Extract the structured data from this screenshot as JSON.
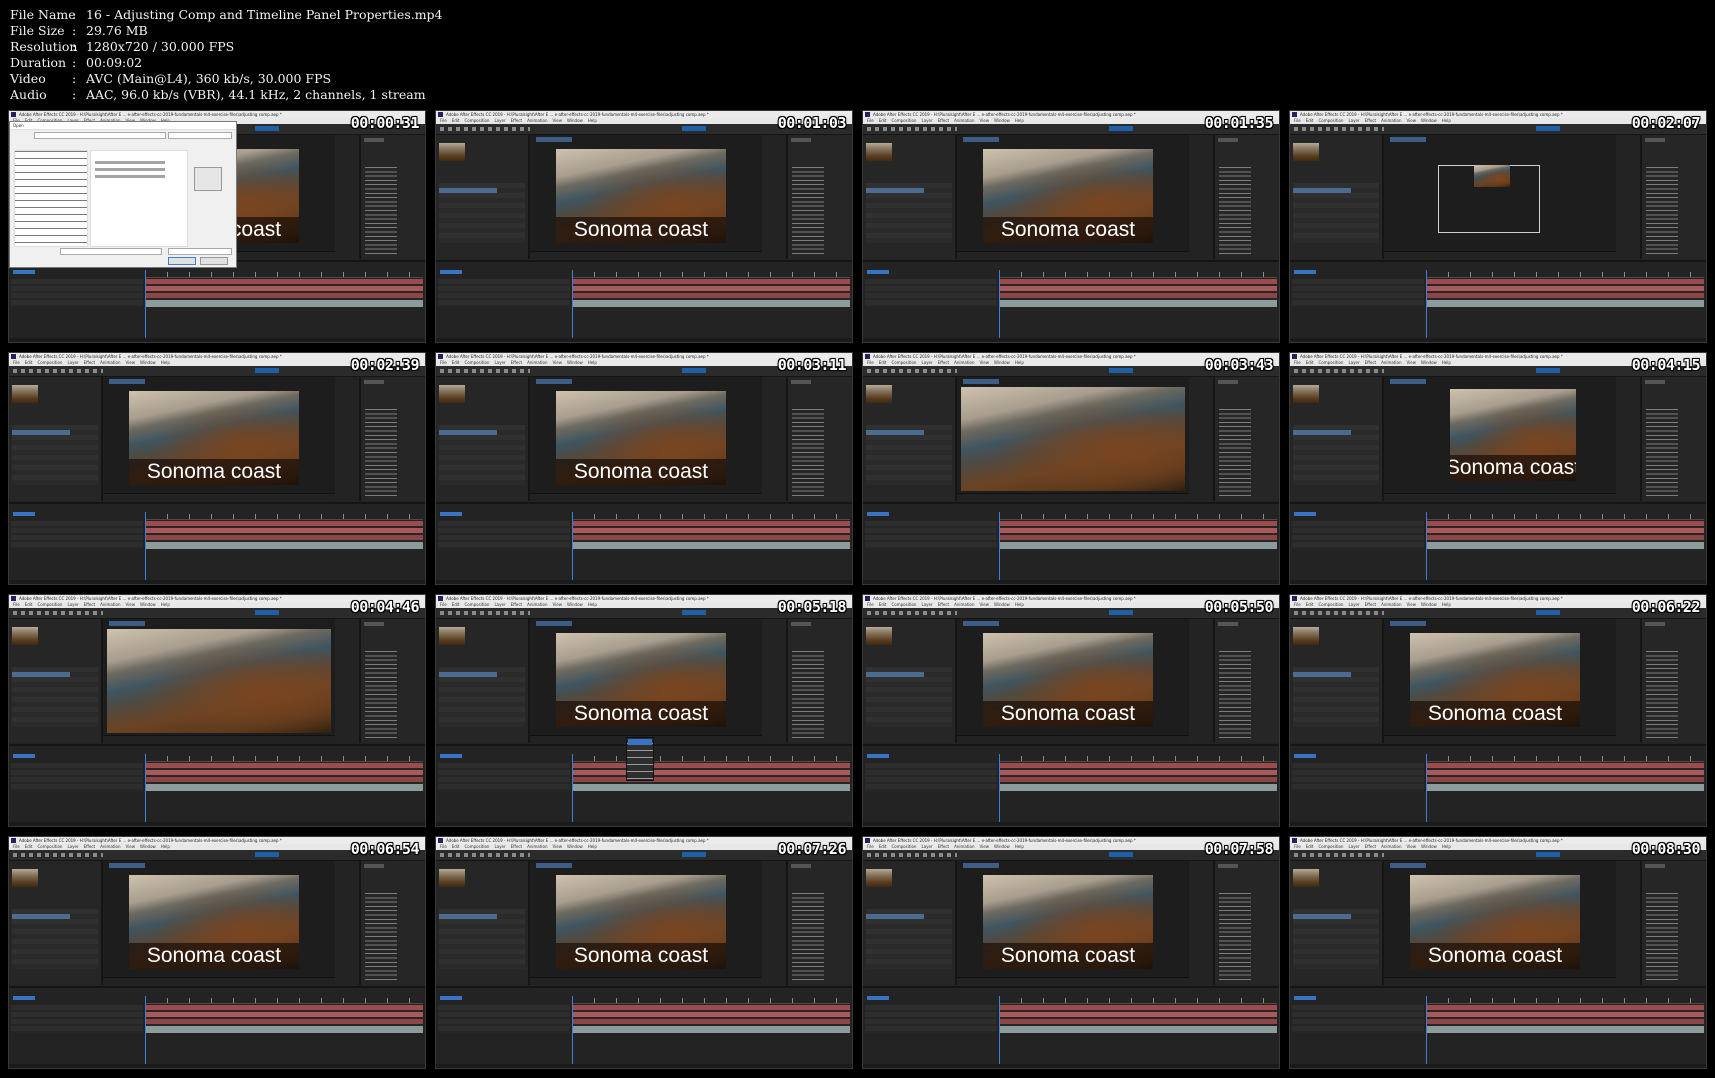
{
  "meta": {
    "rows": [
      {
        "key": "File Name",
        "value": "16 - Adjusting Comp and Timeline Panel Properties.mp4"
      },
      {
        "key": "File Size",
        "value": "29.76 MB"
      },
      {
        "key": "Resolution",
        "value": "1280x720 / 30.000 FPS"
      },
      {
        "key": "Duration",
        "value": "00:09:02"
      },
      {
        "key": "Video",
        "value": "AVC (Main@L4), 360 kb/s, 30.000 FPS"
      },
      {
        "key": "Audio",
        "value": "AAC, 96.0 kb/s (VBR), 44.1 kHz, 2 channels, 1 stream"
      }
    ],
    "separator": ":"
  },
  "app": {
    "window_title": "Adobe After Effects CC 2019 - H:\\Pluralsight\\After E ... e-after-effects-cc-2019-fundamentals-m4-exercise-files\\adjusting comp.aep *",
    "menu": [
      "File",
      "Edit",
      "Composition",
      "Layer",
      "Effect",
      "Animation",
      "View",
      "Window",
      "Help"
    ],
    "comp_title_text": "Sonoma coast"
  },
  "thumbnails": [
    {
      "timestamp": "00:00:31",
      "view": "open-dialog"
    },
    {
      "timestamp": "00:01:03",
      "view": "comp"
    },
    {
      "timestamp": "00:01:35",
      "view": "comp"
    },
    {
      "timestamp": "00:02:07",
      "view": "zoomed-out"
    },
    {
      "timestamp": "00:02:39",
      "view": "comp"
    },
    {
      "timestamp": "00:03:11",
      "view": "comp"
    },
    {
      "timestamp": "00:03:43",
      "view": "full-frame"
    },
    {
      "timestamp": "00:04:15",
      "view": "boxed"
    },
    {
      "timestamp": "00:04:46",
      "view": "full-frame"
    },
    {
      "timestamp": "00:05:18",
      "view": "dropdown"
    },
    {
      "timestamp": "00:05:50",
      "view": "comp"
    },
    {
      "timestamp": "00:06:22",
      "view": "comp"
    },
    {
      "timestamp": "00:06:54",
      "view": "comp"
    },
    {
      "timestamp": "00:07:26",
      "view": "comp"
    },
    {
      "timestamp": "00:07:58",
      "view": "comp"
    },
    {
      "timestamp": "00:08:30",
      "view": "comp"
    }
  ],
  "colors": {
    "background": "#000000",
    "panel": "#232323",
    "accent": "#3a72c4",
    "layer_bar": "#a9585b"
  }
}
